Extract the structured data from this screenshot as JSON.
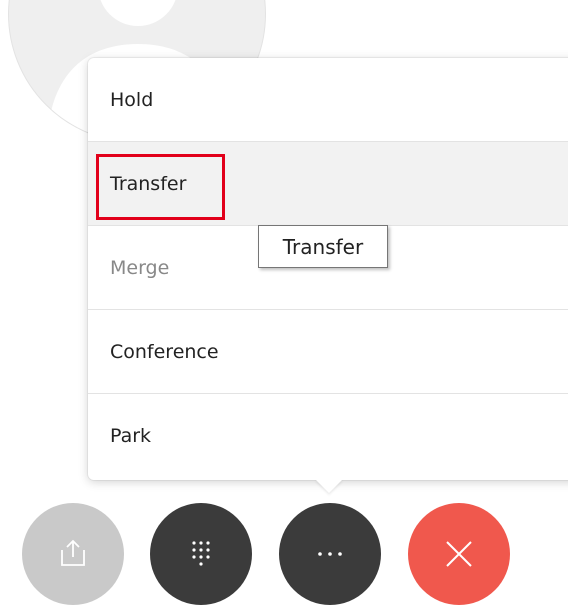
{
  "menu": {
    "items": [
      {
        "label": "Hold",
        "state": "normal"
      },
      {
        "label": "Transfer",
        "state": "hover"
      },
      {
        "label": "Merge",
        "state": "disabled"
      },
      {
        "label": "Conference",
        "state": "normal"
      },
      {
        "label": "Park",
        "state": "normal"
      }
    ]
  },
  "tooltip": {
    "text": "Transfer"
  },
  "controls": [
    {
      "icon": "share-screen-icon",
      "state": "disabled",
      "color": "#c9c9c9"
    },
    {
      "icon": "dialpad-icon",
      "state": "normal",
      "color": "#3b3b3b"
    },
    {
      "icon": "more-options-icon",
      "state": "active",
      "color": "#3b3b3b"
    },
    {
      "icon": "end-call-icon",
      "state": "normal",
      "color": "#f0584d"
    }
  ],
  "colors": {
    "highlight": "#e2001a",
    "end_call": "#f0584d",
    "control_dark": "#3b3b3b",
    "control_disabled": "#c9c9c9"
  }
}
